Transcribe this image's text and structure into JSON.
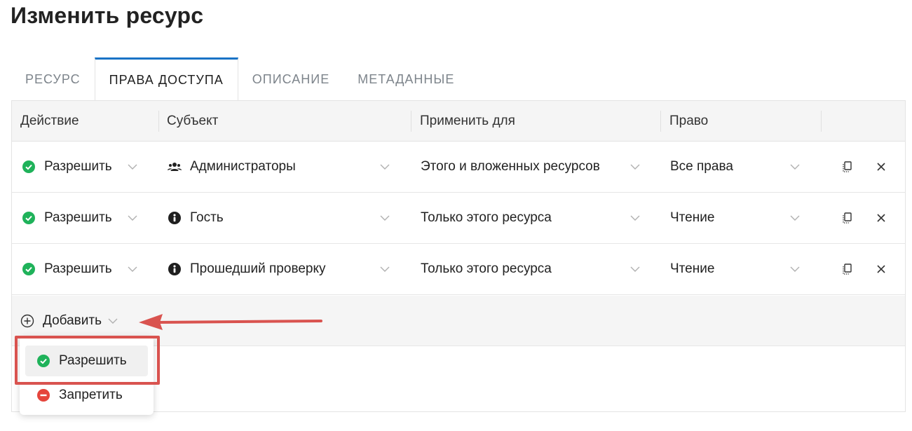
{
  "page": {
    "title": "Изменить ресурс"
  },
  "tabs": [
    {
      "label": "РЕСУРС"
    },
    {
      "label": "ПРАВА ДОСТУПА"
    },
    {
      "label": "ОПИСАНИЕ"
    },
    {
      "label": "МЕТАДАННЫЕ"
    }
  ],
  "active_tab": "ПРАВА ДОСТУПА",
  "table": {
    "headers": {
      "action": "Действие",
      "subject": "Субъект",
      "apply": "Применить для",
      "right": "Право"
    },
    "rows": [
      {
        "action": "Разрешить",
        "subject": "Администраторы",
        "subject_icon": "group-icon",
        "apply": "Этого и вложенных ресурсов",
        "right": "Все права"
      },
      {
        "action": "Разрешить",
        "subject": "Гость",
        "subject_icon": "info-icon",
        "apply": "Только этого ресурса",
        "right": "Чтение"
      },
      {
        "action": "Разрешить",
        "subject": "Прошедший проверку",
        "subject_icon": "info-icon",
        "apply": "Только этого ресурса",
        "right": "Чтение"
      }
    ]
  },
  "add": {
    "label": "Добавить"
  },
  "dropdown": {
    "items": [
      {
        "label": "Разрешить",
        "icon": "allow-check-icon",
        "highlighted": true
      },
      {
        "label": "Запретить",
        "icon": "deny-minus-icon",
        "highlighted": false
      }
    ]
  },
  "colors": {
    "accent": "#1a73c6",
    "allow": "#1fb25a",
    "deny": "#e5453c",
    "annotation": "#d9534f"
  }
}
